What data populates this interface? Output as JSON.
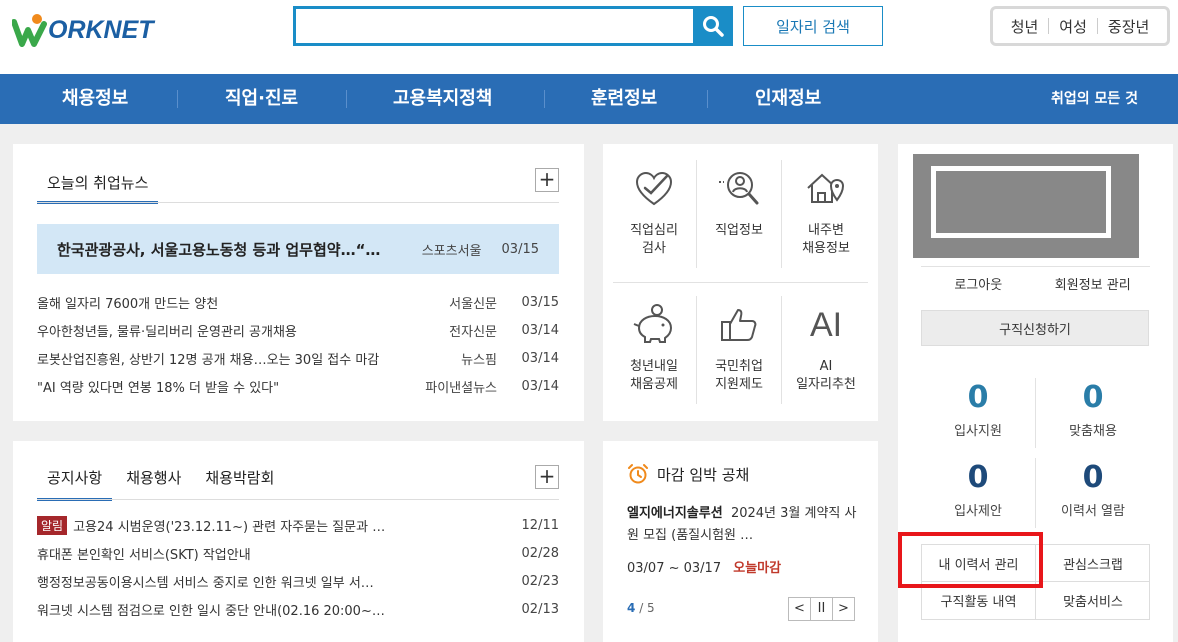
{
  "header": {
    "logo_text": "ORKNET",
    "search_placeholder": "",
    "job_search_label": "일자리 검색",
    "audience": [
      "청년",
      "여성",
      "중장년"
    ]
  },
  "nav": {
    "items": [
      "채용정보",
      "직업·진로",
      "고용복지정책",
      "훈련정보",
      "인재정보"
    ],
    "all_label": "취업의 모든 것"
  },
  "news": {
    "tab": "오늘의 취업뉴스",
    "highlight": {
      "title": "한국관광공사, 서울고용노동청 등과 업무협약…“…",
      "source": "스포츠서울",
      "date": "03/15"
    },
    "items": [
      {
        "title": "올해 일자리 7600개 만드는 양천",
        "source": "서울신문",
        "date": "03/15"
      },
      {
        "title": "우아한청년들, 물류·딜리버리 운영관리 공개채용",
        "source": "전자신문",
        "date": "03/14"
      },
      {
        "title": "로봇산업진흥원, 상반기 12명 공개 채용…오는 30일 접수 마감",
        "source": "뉴스핌",
        "date": "03/14"
      },
      {
        "title": "\"AI 역량 있다면 연봉 18% 더 받을 수 있다\"",
        "source": "파이낸셜뉴스",
        "date": "03/14"
      }
    ]
  },
  "notice": {
    "tabs": [
      "공지사항",
      "채용행사",
      "채용박람회"
    ],
    "badge": "알림",
    "items": [
      {
        "title": "고용24 시범운영('23.12.11~) 관련 자주묻는 질문과 …",
        "date": "12/11"
      },
      {
        "title": "휴대폰 본인확인 서비스(SKT) 작업안내",
        "date": "02/28"
      },
      {
        "title": "행정정보공동이용시스템 서비스 중지로 인한 워크넷 일부 서…",
        "date": "02/23"
      },
      {
        "title": "워크넷 시스템 점검으로 인한 일시 중단 안내(02.16 20:00~…",
        "date": "02/13"
      }
    ]
  },
  "services": {
    "items": [
      {
        "line1": "직업심리",
        "line2": "검사"
      },
      {
        "line1": "직업정보",
        "line2": ""
      },
      {
        "line1": "내주변",
        "line2": "채용정보"
      },
      {
        "line1": "청년내일",
        "line2": "채움공제"
      },
      {
        "line1": "국민취업",
        "line2": "지원제도"
      },
      {
        "line1": "AI",
        "line2": "일자리추천"
      }
    ],
    "ai_glyph": "AI"
  },
  "deadline": {
    "title": "마감 임박 공채",
    "company": "엘지에너지솔루션",
    "desc": "2024년 3월 계약직 사원 모집 (품질시험원 …",
    "period": "03/07 ~ 03/17",
    "urgent": "오늘마감",
    "page_current": "4",
    "page_total": "/ 5",
    "prev": "<",
    "pause": "II",
    "next": ">"
  },
  "mypage": {
    "logout": "로그아웃",
    "member_info": "회원정보 관리",
    "apply_label": "구직신청하기",
    "stats": [
      {
        "value": "0",
        "label": "입사지원"
      },
      {
        "value": "0",
        "label": "맞춤채용"
      },
      {
        "value": "0",
        "label": "입사제안"
      },
      {
        "value": "0",
        "label": "이력서 열람"
      }
    ],
    "links": [
      "내 이력서 관리",
      "관심스크랩",
      "구직활동 내역",
      "맞춤서비스"
    ]
  },
  "colors": {
    "primary": "#2a6db5",
    "search": "#1a8dc7",
    "badge": "#a5272b",
    "highlight_box": "#e8161a"
  }
}
